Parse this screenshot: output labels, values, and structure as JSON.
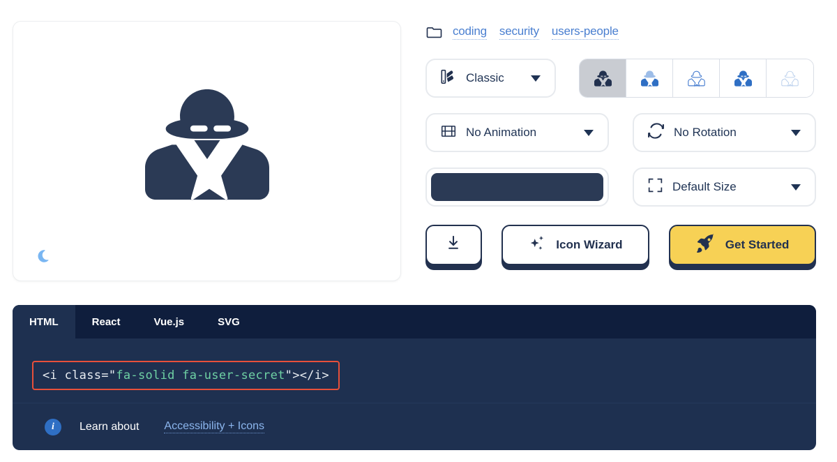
{
  "preview": {
    "icon_name": "user-secret-icon",
    "icon_color": "#2b3a55",
    "theme_toggle": "moon-icon"
  },
  "breadcrumb": {
    "folder_icon": "folder-icon",
    "links": [
      "coding",
      "security",
      "users-people"
    ]
  },
  "controls": {
    "style": {
      "icon": "palette-swatch-icon",
      "value": "Classic"
    },
    "variants": [
      {
        "name": "classic-solid",
        "active": true
      },
      {
        "name": "duotone",
        "active": false
      },
      {
        "name": "thin-outline",
        "active": false
      },
      {
        "name": "solid-blue",
        "active": false
      },
      {
        "name": "light-outline",
        "active": false
      }
    ],
    "animation": {
      "icon": "film-icon",
      "value": "No Animation"
    },
    "rotation": {
      "icon": "rotate-icon",
      "value": "No Rotation"
    },
    "color": {
      "name": "color-swatch",
      "value": "#2b3a55"
    },
    "size": {
      "icon": "expand-icon",
      "value": "Default Size"
    }
  },
  "actions": {
    "download": {
      "icon": "download-icon",
      "label": ""
    },
    "wizard": {
      "icon": "sparkles-icon",
      "label": "Icon Wizard"
    },
    "get_started": {
      "icon": "rocket-icon",
      "label": "Get Started",
      "color": "#f7d155"
    }
  },
  "code_panel": {
    "tabs": [
      {
        "label": "HTML",
        "active": true
      },
      {
        "label": "React",
        "active": false
      },
      {
        "label": "Vue.js",
        "active": false
      },
      {
        "label": "SVG",
        "active": false
      }
    ],
    "snippet": {
      "prefix": "<i class=\"",
      "class_value": "fa-solid fa-user-secret",
      "suffix": "\"></i>"
    },
    "footer": {
      "info_glyph": "i",
      "text": "Learn about",
      "link": "Accessibility + Icons"
    }
  }
}
